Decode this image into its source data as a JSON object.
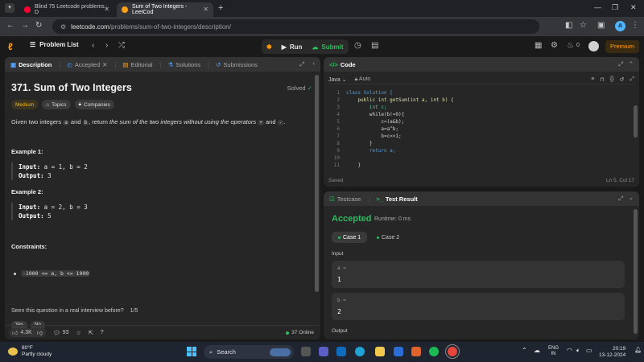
{
  "browser": {
    "tabs": [
      {
        "title": "Blind 75 Leetcode problems : D",
        "favicon": "youtube-icon"
      },
      {
        "title": "Sum of Two Integers - LeetCod",
        "favicon": "leetcode-icon"
      }
    ],
    "url_domain": "leetcode.com",
    "url_path": "/problems/sum-of-two-integers/description/",
    "profile_initial": "A"
  },
  "lcnav": {
    "problem_list": "Problem List",
    "run": "Run",
    "submit": "Submit",
    "coins": "0",
    "premium": "Premium"
  },
  "left": {
    "tabs": [
      "Description",
      "Accepted",
      "Editorial",
      "Solutions",
      "Submissions"
    ],
    "title": "371. Sum of Two Integers",
    "solved": "Solved",
    "tags": [
      "Medium",
      "Topics",
      "Companies"
    ],
    "desc": {
      "p1": "Given two integers ",
      "a": "a",
      "p2": " and ",
      "b": "b",
      "p3": ", return ",
      "em": "the sum of the two integers without using the operators",
      "p4": " ",
      "plus": "+",
      "p5": " and ",
      "minus": "-",
      "p6": "."
    },
    "example1": {
      "title": "Example 1:",
      "input_label": "Input:",
      "input": "a = 1, b = 2",
      "output_label": "Output:",
      "output": "3"
    },
    "example2": {
      "title": "Example 2:",
      "input_label": "Input:",
      "input": "a = 2, b = 3",
      "output_label": "Output:",
      "output": "5"
    },
    "constraints_title": "Constraints:",
    "constraint": "-1000 <= a, b <= 1000",
    "interview_q": "Seen this question in a real interview before?",
    "interview_page": "1/5",
    "yes": "Yes",
    "no": "No",
    "likes": "4.3K",
    "comments": "93",
    "online": "37 Online"
  },
  "code": {
    "header": "Code",
    "language": "Java",
    "auto": "Auto",
    "lines": [
      {
        "n": "1",
        "t": "class Solution {"
      },
      {
        "n": "2",
        "t": "    public int getSum(int a, int b) {"
      },
      {
        "n": "3",
        "t": "        int c;"
      },
      {
        "n": "4",
        "t": "        while(b!=0){"
      },
      {
        "n": "5",
        "t": "            c=(a&b);"
      },
      {
        "n": "6",
        "t": "            a=a^b;"
      },
      {
        "n": "7",
        "t": "            b=c<<1;"
      },
      {
        "n": "8",
        "t": "        }"
      },
      {
        "n": "9",
        "t": "        return a;"
      },
      {
        "n": "10",
        "t": ""
      },
      {
        "n": "11",
        "t": "    }"
      }
    ],
    "saved": "Saved",
    "cursor": "Ln 5, Col 17"
  },
  "result": {
    "tabs": [
      "Testcase",
      "Test Result"
    ],
    "status": "Accepted",
    "runtime": "Runtime: 0 ms",
    "cases": [
      "Case 1",
      "Case 2"
    ],
    "input_label": "Input",
    "vars": [
      {
        "name": "a =",
        "value": "1"
      },
      {
        "name": "b =",
        "value": "2"
      }
    ],
    "output_label": "Output"
  },
  "taskbar": {
    "temp": "80°F",
    "condition": "Partly cloudy",
    "search": "Search",
    "lang1": "ENG",
    "lang2": "IN",
    "time": "20:19",
    "date": "13-12-2024"
  },
  "colors": {
    "accent": "#ffa116",
    "success": "#2cbb5d",
    "medium": "#ffb800"
  }
}
